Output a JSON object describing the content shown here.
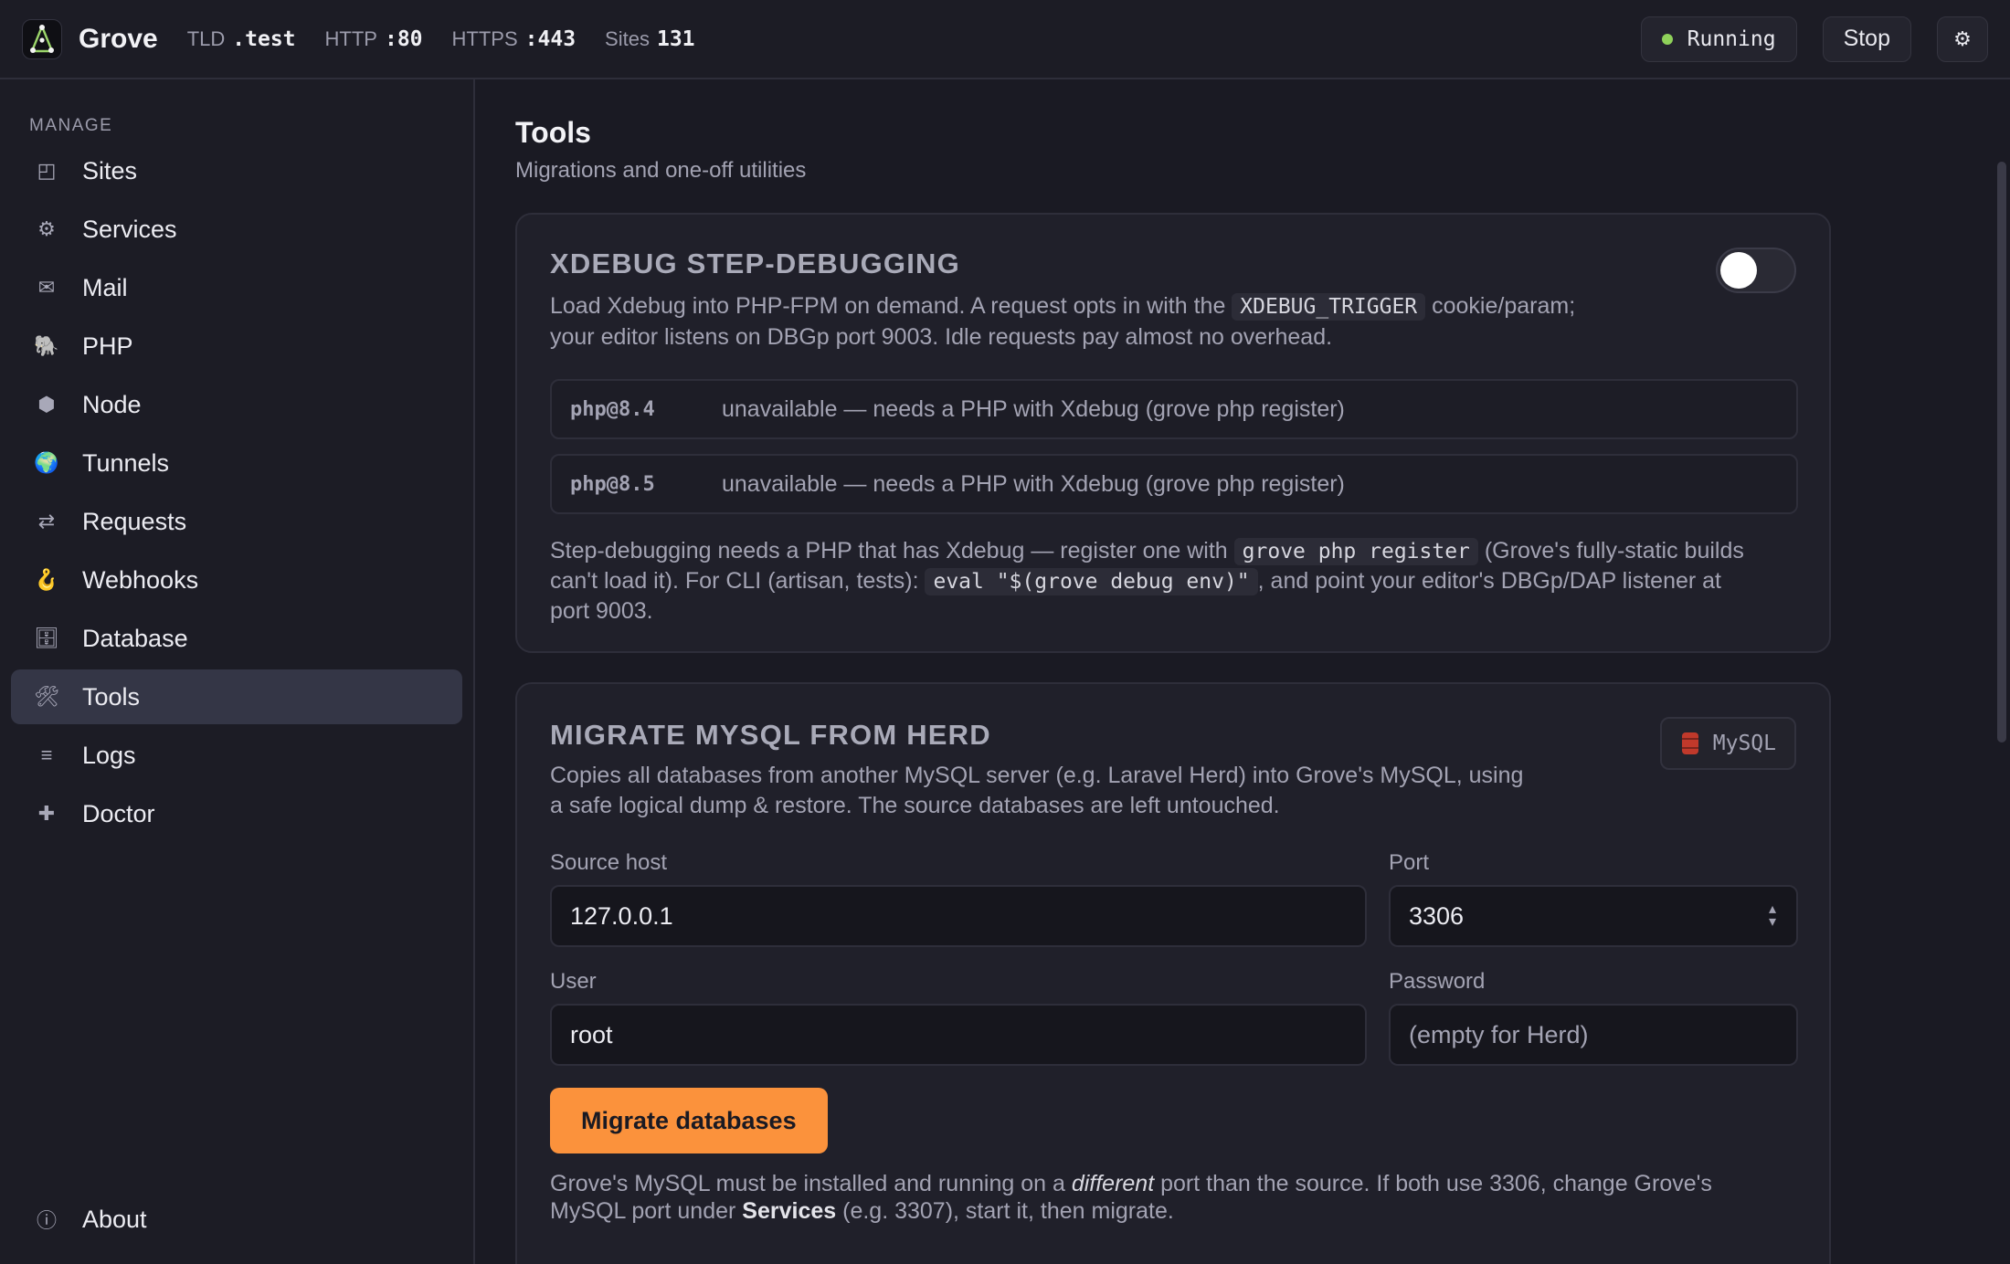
{
  "app": {
    "name": "Grove",
    "stats": [
      {
        "label": "TLD",
        "value": ".test"
      },
      {
        "label": "HTTP",
        "value": ":80"
      },
      {
        "label": "HTTPS",
        "value": ":443"
      },
      {
        "label": "Sites",
        "value": "131"
      }
    ],
    "status": "Running",
    "stop_label": "Stop",
    "colors": {
      "accent": "#fb923c",
      "running": "#8fd15a",
      "bg": "#1a1a23"
    }
  },
  "sidebar": {
    "section": "MANAGE",
    "items": [
      {
        "label": "Sites",
        "icon": "sites-icon",
        "glyph": "◰"
      },
      {
        "label": "Services",
        "icon": "gear-icon",
        "glyph": "⚙"
      },
      {
        "label": "Mail",
        "icon": "mail-icon",
        "glyph": "✉"
      },
      {
        "label": "PHP",
        "icon": "elephant-icon",
        "glyph": "🐘"
      },
      {
        "label": "Node",
        "icon": "hexagon-icon",
        "glyph": "⬢"
      },
      {
        "label": "Tunnels",
        "icon": "globe-icon",
        "glyph": "🌍"
      },
      {
        "label": "Requests",
        "icon": "arrows-icon",
        "glyph": "⇄"
      },
      {
        "label": "Webhooks",
        "icon": "hook-icon",
        "glyph": "🪝"
      },
      {
        "label": "Database",
        "icon": "cabinet-icon",
        "glyph": "🗄"
      },
      {
        "label": "Tools",
        "icon": "tools-icon",
        "glyph": "🛠"
      },
      {
        "label": "Logs",
        "icon": "list-icon",
        "glyph": "≡"
      },
      {
        "label": "Doctor",
        "icon": "plus-icon",
        "glyph": "✚"
      }
    ],
    "about": {
      "label": "About",
      "glyph": "ⓘ"
    }
  },
  "page": {
    "title": "Tools",
    "subtitle": "Migrations and one-off utilities"
  },
  "xdebug": {
    "title": "XDEBUG STEP-DEBUGGING",
    "desc_1": "Load Xdebug into PHP-FPM on demand. A request opts in with the",
    "desc_code": "XDEBUG_TRIGGER",
    "desc_2": "cookie/param;",
    "desc_3": "your editor listens on DBGp port 9003. Idle requests pay almost no overhead.",
    "enabled": false,
    "versions": [
      {
        "version": "php@8.4",
        "status": "unavailable — needs a PHP with Xdebug (grove php register)"
      },
      {
        "version": "php@8.5",
        "status": "unavailable — needs a PHP with Xdebug (grove php register)"
      }
    ],
    "note_1": "Step-debugging needs a PHP that has Xdebug — register one with",
    "note_code_1": "grove php register",
    "note_2": "(Grove's fully-static builds",
    "note_3": "can't load it). For CLI (artisan, tests):",
    "note_code_2": "eval \"$(grove debug env)\"",
    "note_4": ", and point your editor's DBGp/DAP listener at",
    "note_5": "port 9003."
  },
  "migrate": {
    "title": "MIGRATE MYSQL FROM HERD",
    "badge": "MySQL",
    "desc_1": "Copies all databases from another MySQL server (e.g. Laravel Herd) into Grove's MySQL, using",
    "desc_2": "a safe logical dump & restore. The source databases are left untouched.",
    "source_host_label": "Source host",
    "source_host_value": "127.0.0.1",
    "port_label": "Port",
    "port_value": "3306",
    "user_label": "User",
    "user_value": "root",
    "password_label": "Password",
    "password_placeholder": "(empty for Herd)",
    "button": "Migrate databases",
    "note_1": "Grove's MySQL must be installed and running on a",
    "note_em": "different",
    "note_2": "port than the source. If both use 3306, change Grove's",
    "note_3": "MySQL port under",
    "note_b": "Services",
    "note_4": "(e.g. 3307), start it, then migrate."
  }
}
